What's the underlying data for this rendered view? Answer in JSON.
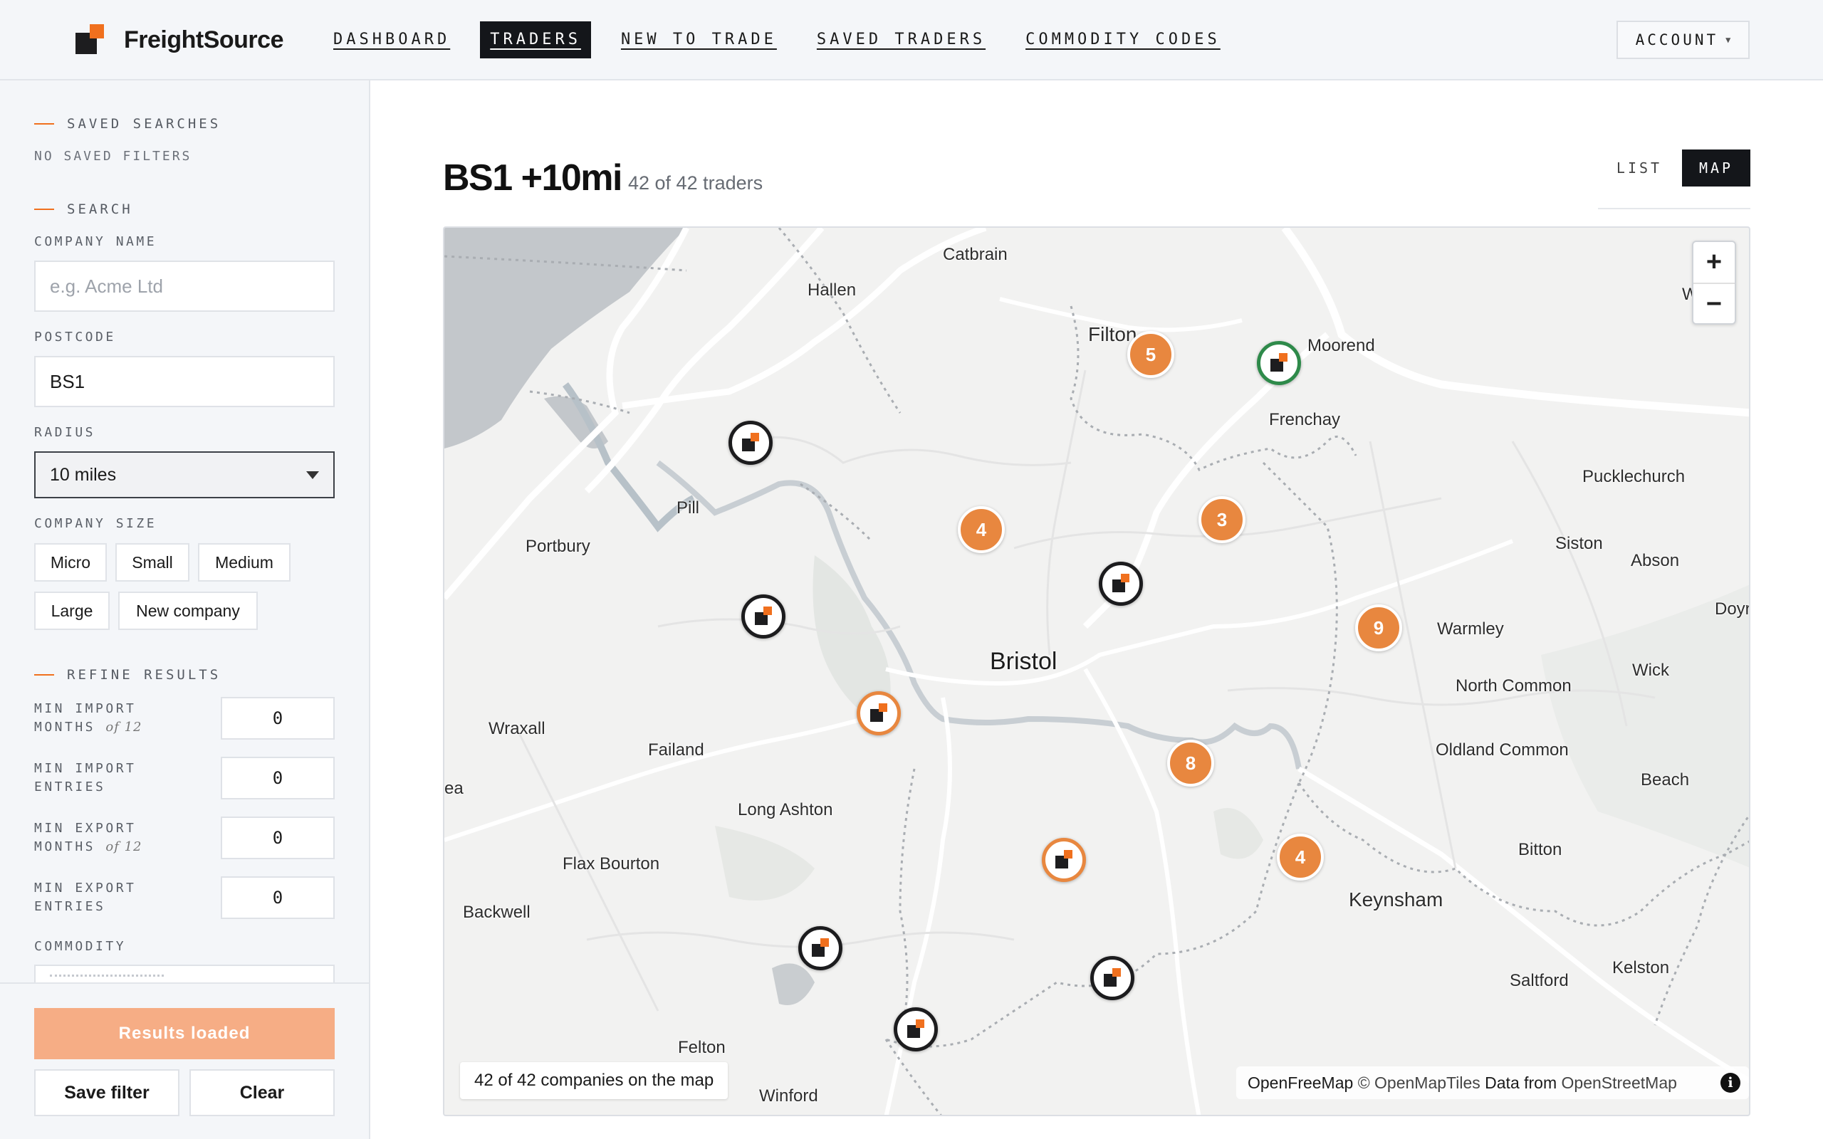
{
  "header": {
    "brand": "FreightSource",
    "nav": [
      {
        "label": "DASHBOARD",
        "active": false
      },
      {
        "label": "TRADERS",
        "active": true
      },
      {
        "label": "NEW TO TRADE",
        "active": false
      },
      {
        "label": "SAVED TRADERS",
        "active": false
      },
      {
        "label": "COMMODITY CODES",
        "active": false
      }
    ],
    "account_label": "ACCOUNT",
    "accent_color": "#f0701e"
  },
  "sidebar": {
    "saved_searches": {
      "title": "SAVED SEARCHES",
      "empty": "NO SAVED FILTERS"
    },
    "search": {
      "title": "SEARCH",
      "company_name_label": "COMPANY NAME",
      "company_name_placeholder": "e.g. Acme Ltd",
      "postcode_label": "POSTCODE",
      "postcode_value": "BS1",
      "radius_label": "RADIUS",
      "radius_value": "10 miles",
      "company_size_label": "COMPANY SIZE",
      "sizes": [
        "Micro",
        "Small",
        "Medium",
        "Large",
        "New company"
      ]
    },
    "refine": {
      "title": "REFINE RESULTS",
      "fields": [
        {
          "line1": "MIN IMPORT",
          "line2": "MONTHS",
          "suffix": "of 12",
          "value": "0"
        },
        {
          "line1": "MIN IMPORT",
          "line2": "ENTRIES",
          "suffix": "",
          "value": "0"
        },
        {
          "line1": "MIN EXPORT",
          "line2": "MONTHS",
          "suffix": "of 12",
          "value": "0"
        },
        {
          "line1": "MIN EXPORT",
          "line2": "ENTRIES",
          "suffix": "",
          "value": "0"
        }
      ],
      "commodity_label": "COMMODITY"
    },
    "footer": {
      "primary": "Results loaded",
      "save": "Save filter",
      "clear": "Clear"
    }
  },
  "main": {
    "title": "BS1 +10mi",
    "subtitle": "42 of 42 traders",
    "view_toggle": {
      "list": "LIST",
      "map": "MAP",
      "active": "map"
    }
  },
  "map": {
    "places": [
      {
        "name": "Catbrain",
        "size": "normal"
      },
      {
        "name": "Hallen",
        "size": "normal"
      },
      {
        "name": "Filton",
        "size": "med"
      },
      {
        "name": "Moorend",
        "size": "normal"
      },
      {
        "name": "Frenchay",
        "size": "normal"
      },
      {
        "name": "Pill",
        "size": "normal"
      },
      {
        "name": "Portbury",
        "size": "normal"
      },
      {
        "name": "Pucklechurch",
        "size": "normal"
      },
      {
        "name": "Siston",
        "size": "normal"
      },
      {
        "name": "Abson",
        "size": "normal"
      },
      {
        "name": "Doyr",
        "size": "normal"
      },
      {
        "name": "Warmley",
        "size": "normal"
      },
      {
        "name": "Bristol",
        "size": "big"
      },
      {
        "name": "North Common",
        "size": "normal"
      },
      {
        "name": "Wick",
        "size": "normal"
      },
      {
        "name": "Wraxall",
        "size": "normal"
      },
      {
        "name": "Failand",
        "size": "normal"
      },
      {
        "name": "Oldland Common",
        "size": "normal"
      },
      {
        "name": "ea",
        "size": "normal"
      },
      {
        "name": "Beach",
        "size": "normal"
      },
      {
        "name": "Long Ashton",
        "size": "normal"
      },
      {
        "name": "Flax Bourton",
        "size": "normal"
      },
      {
        "name": "Bitton",
        "size": "normal"
      },
      {
        "name": "Keynsham",
        "size": "med"
      },
      {
        "name": "Backwell",
        "size": "normal"
      },
      {
        "name": "Kelston",
        "size": "normal"
      },
      {
        "name": "Saltford",
        "size": "normal"
      },
      {
        "name": "Felton",
        "size": "normal"
      },
      {
        "name": "Winford",
        "size": "normal"
      },
      {
        "name": "W...y",
        "size": "normal"
      }
    ],
    "clusters": [
      "5",
      "4",
      "3",
      "9",
      "8",
      "4"
    ],
    "marker_count": 10,
    "count_label": "42 of 42 companies on the map",
    "attribution": {
      "a": "OpenFreeMap",
      "b": "© OpenMapTiles",
      "c": "Data from",
      "d": "OpenStreetMap"
    },
    "zoom_in": "+",
    "zoom_out": "−",
    "info_icon": "i",
    "colors": {
      "cluster": "#e8873f",
      "marker_default": "#1c1c1e",
      "marker_highlight": "#e8873f",
      "marker_saved": "#2e8a4a"
    }
  }
}
